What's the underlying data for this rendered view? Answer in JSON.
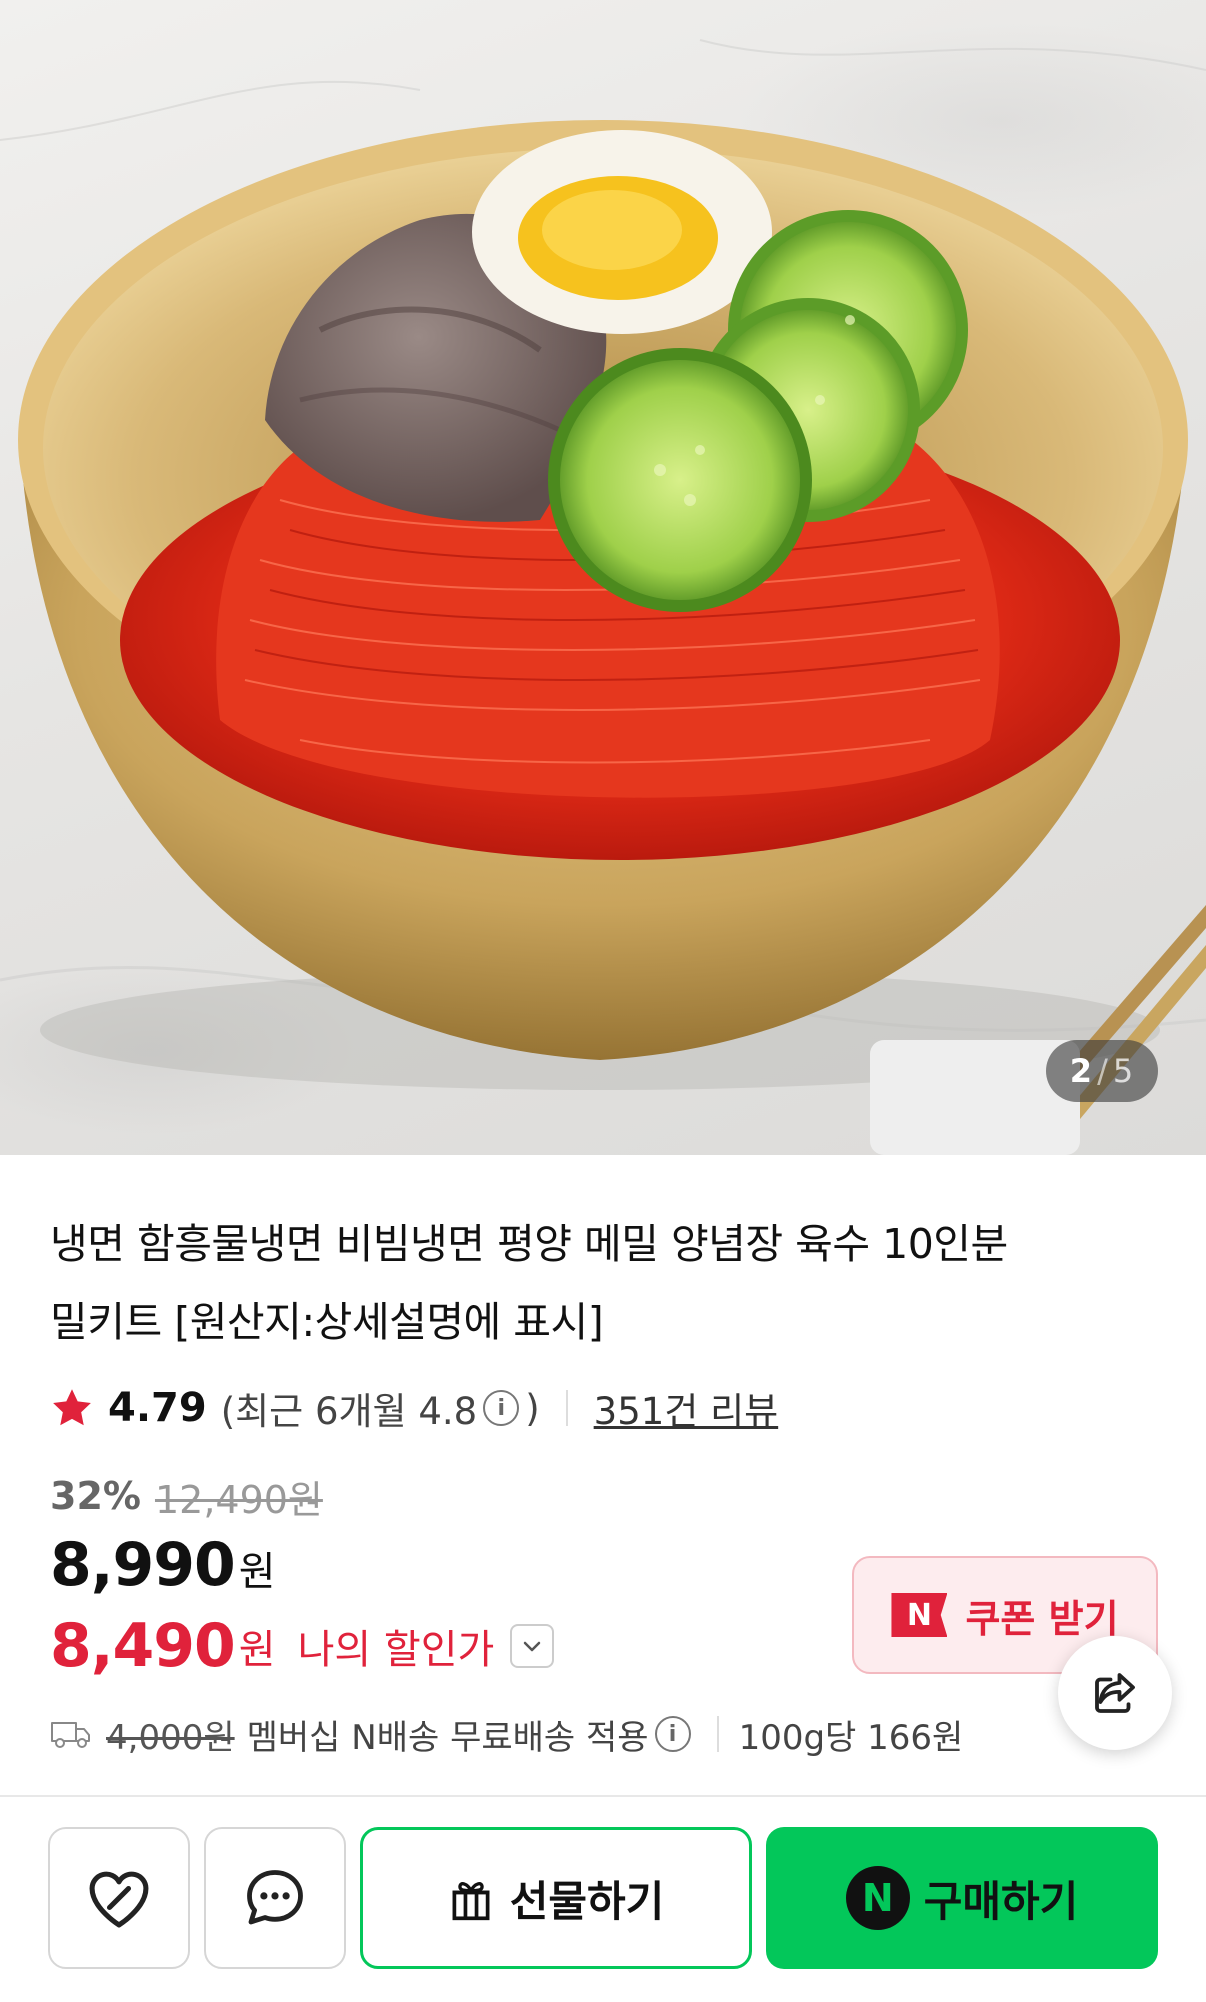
{
  "image": {
    "counter_current": "2",
    "counter_sep": "/",
    "counter_total": "5"
  },
  "product": {
    "title_line1": "냉면 함흥물냉면 비빔냉면 평양 메밀 양념장 육수 10인분",
    "title_line2": "밀키트 [원산지:상세설명에 표시]"
  },
  "rating": {
    "icon": "star-icon",
    "score": "4.79",
    "recent_open": "(최근 6개월 4.8",
    "info_glyph": "i",
    "recent_close": ")",
    "reviews": "351건 리뷰"
  },
  "price": {
    "discount_rate": "32%",
    "original": "12,490원",
    "sale": "8,990",
    "sale_unit": "원",
    "my_price": "8,490",
    "my_unit": "원",
    "my_label": "나의 할인가"
  },
  "coupon": {
    "badge": "N",
    "label": "쿠폰 받기"
  },
  "shipping": {
    "fee": "4,000원",
    "text": "멤버십 N배송 무료배송 적용",
    "info_glyph": "i",
    "unit_price": "100g당 166원"
  },
  "actions": {
    "gift_label": "선물하기",
    "buy_badge": "N",
    "buy_label": "구매하기"
  },
  "colors": {
    "accent_green": "#03c75a",
    "accent_red": "#e0223b"
  }
}
